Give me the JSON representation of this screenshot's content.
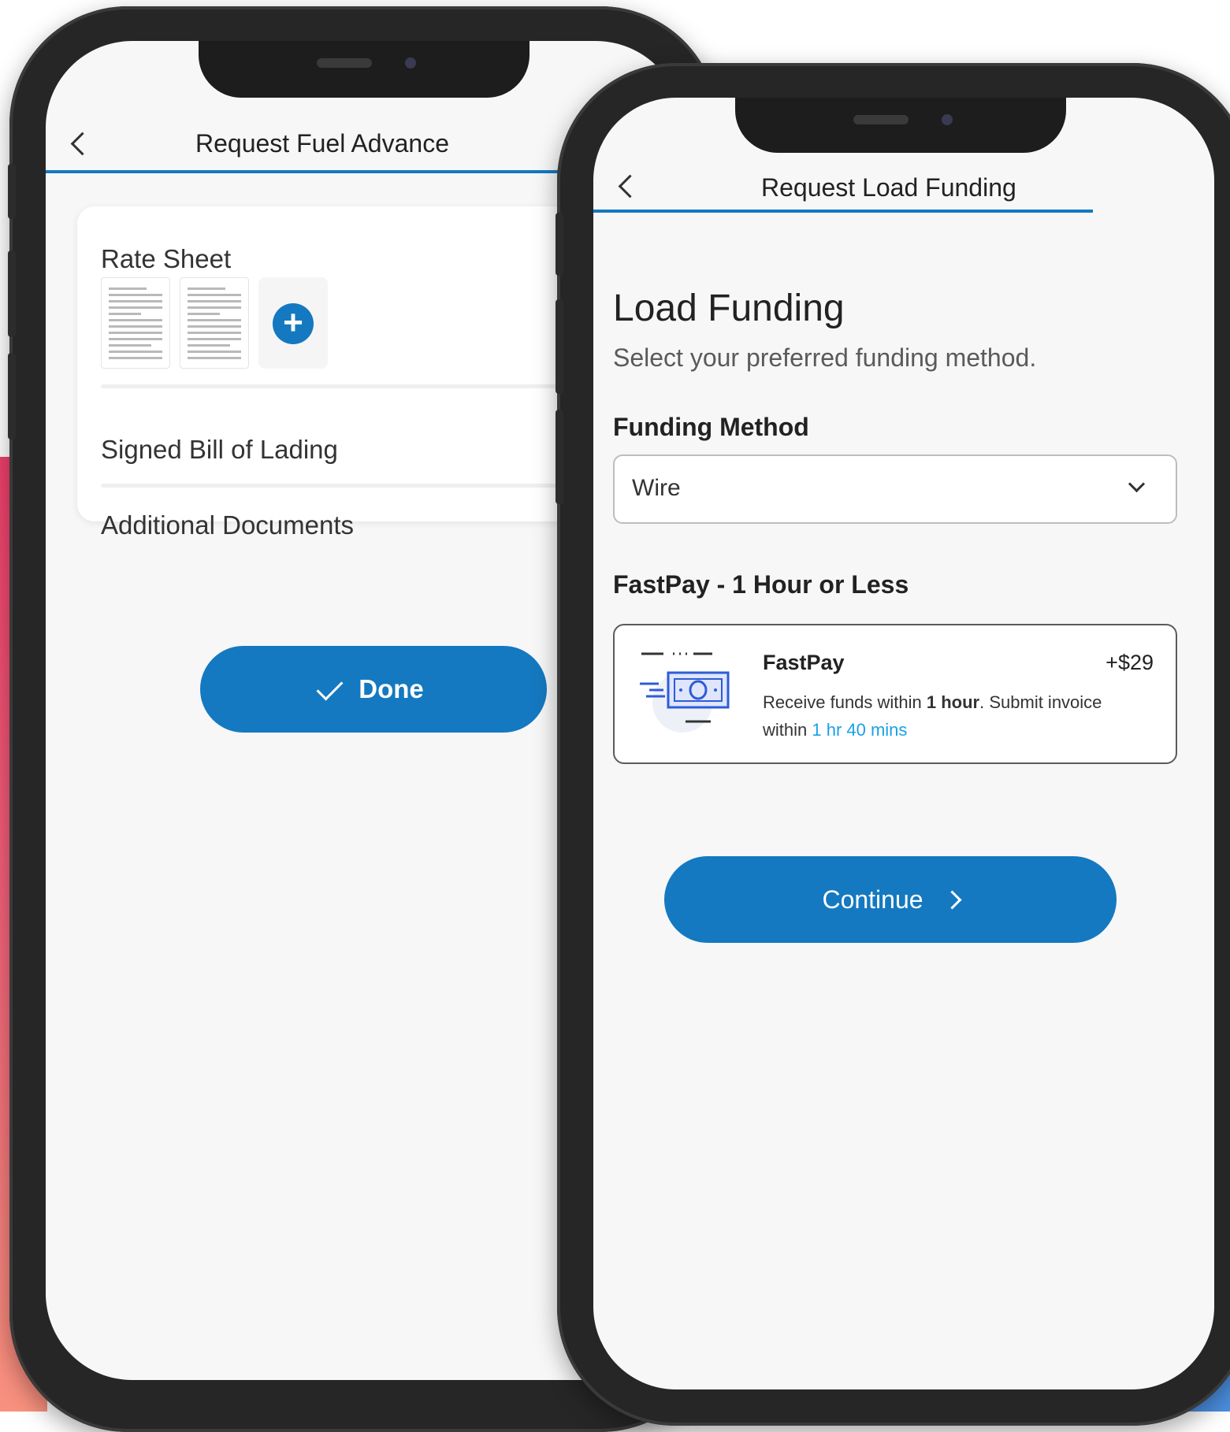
{
  "phone_fuel_advance": {
    "header": {
      "title": "Request Fuel Advance"
    },
    "sections": [
      {
        "label": "Rate Sheet"
      },
      {
        "label": "Signed Bill of Lading"
      },
      {
        "label": "Additional Documents"
      }
    ],
    "add_button_label": "+",
    "done_button": {
      "label": "Done",
      "icon": "check-icon"
    }
  },
  "phone_load_funding": {
    "header": {
      "title": "Request Load Funding"
    },
    "heading": "Load Funding",
    "subtitle": "Select your preferred funding method.",
    "funding_method": {
      "label": "Funding Method",
      "selected": "Wire"
    },
    "fastpay_section": {
      "label": "FastPay - 1 Hour or Less",
      "option": {
        "name": "FastPay",
        "price": "+$29",
        "desc_prefix": "Receive funds within ",
        "desc_bold": "1 hour",
        "desc_middle": ". Submit invoice within ",
        "desc_link": "1 hr 40 mins",
        "icon": "money-transfer-icon"
      }
    },
    "continue_button": {
      "label": "Continue",
      "icon": "chevron-right-icon"
    }
  },
  "colors": {
    "primary": "#1479c0",
    "link": "#1aa0e8",
    "accent_gradient": [
      "#ef3f6b",
      "#f8917e"
    ]
  }
}
